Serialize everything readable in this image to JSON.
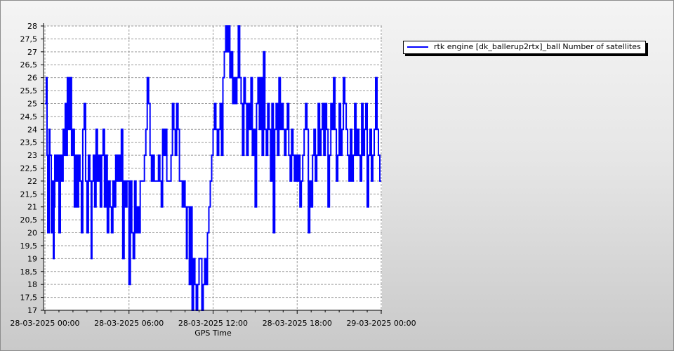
{
  "chart_data": {
    "type": "line",
    "title": "",
    "xlabel": "GPS Time",
    "ylabel": "",
    "x_ticks": [
      "28-03-2025 00:00",
      "28-03-2025 06:00",
      "28-03-2025 12:00",
      "28-03-2025 18:00",
      "29-03-2025 00:00"
    ],
    "y_ticks": [
      "17",
      "17,5",
      "18",
      "18,5",
      "19",
      "19,5",
      "20",
      "20,5",
      "21",
      "21,5",
      "22",
      "22,5",
      "23",
      "23,5",
      "24",
      "24,5",
      "25",
      "25,5",
      "26",
      "26,5",
      "27",
      "27,5",
      "28"
    ],
    "xlim": [
      -0.1,
      24.05
    ],
    "ylim": [
      17,
      28
    ],
    "grid": true,
    "legend_position": "top-right outside plot",
    "series": [
      {
        "name": "rtk engine [dk_ballerup2rtx]_ball Number of satellites",
        "color": "#0000ff",
        "x_unit": "hours since 28-03-2025 00:00",
        "points": [
          [
            0.0,
            25
          ],
          [
            0.1,
            26
          ],
          [
            0.15,
            23
          ],
          [
            0.2,
            20
          ],
          [
            0.3,
            24
          ],
          [
            0.35,
            23
          ],
          [
            0.45,
            20
          ],
          [
            0.5,
            22
          ],
          [
            0.6,
            19
          ],
          [
            0.65,
            21
          ],
          [
            0.7,
            23
          ],
          [
            0.8,
            22
          ],
          [
            0.9,
            23
          ],
          [
            1.0,
            20
          ],
          [
            1.1,
            23
          ],
          [
            1.2,
            22
          ],
          [
            1.3,
            24
          ],
          [
            1.35,
            23
          ],
          [
            1.45,
            25
          ],
          [
            1.5,
            23
          ],
          [
            1.6,
            26
          ],
          [
            1.7,
            24
          ],
          [
            1.8,
            26
          ],
          [
            1.9,
            23
          ],
          [
            2.0,
            24
          ],
          [
            2.1,
            21
          ],
          [
            2.2,
            23
          ],
          [
            2.3,
            21
          ],
          [
            2.4,
            23
          ],
          [
            2.5,
            22
          ],
          [
            2.6,
            20
          ],
          [
            2.7,
            24
          ],
          [
            2.8,
            25
          ],
          [
            2.9,
            22
          ],
          [
            3.0,
            20
          ],
          [
            3.1,
            23
          ],
          [
            3.2,
            22
          ],
          [
            3.3,
            19
          ],
          [
            3.35,
            22
          ],
          [
            3.45,
            23
          ],
          [
            3.55,
            21
          ],
          [
            3.65,
            24
          ],
          [
            3.75,
            22
          ],
          [
            3.85,
            23
          ],
          [
            3.95,
            21
          ],
          [
            4.05,
            23
          ],
          [
            4.15,
            24
          ],
          [
            4.25,
            21
          ],
          [
            4.35,
            23
          ],
          [
            4.45,
            20
          ],
          [
            4.55,
            22
          ],
          [
            4.65,
            21
          ],
          [
            4.75,
            20
          ],
          [
            4.85,
            22
          ],
          [
            4.95,
            21
          ],
          [
            5.05,
            23
          ],
          [
            5.15,
            22
          ],
          [
            5.25,
            23
          ],
          [
            5.35,
            22
          ],
          [
            5.45,
            24
          ],
          [
            5.55,
            19
          ],
          [
            5.65,
            22
          ],
          [
            5.75,
            21
          ],
          [
            5.85,
            22
          ],
          [
            6.0,
            18
          ],
          [
            6.1,
            22
          ],
          [
            6.2,
            20
          ],
          [
            6.3,
            19
          ],
          [
            6.4,
            22
          ],
          [
            6.5,
            20
          ],
          [
            6.6,
            21
          ],
          [
            6.7,
            20
          ],
          [
            6.8,
            22
          ],
          [
            7.0,
            22
          ],
          [
            7.1,
            23
          ],
          [
            7.2,
            24
          ],
          [
            7.3,
            26
          ],
          [
            7.4,
            25
          ],
          [
            7.5,
            23
          ],
          [
            7.6,
            22
          ],
          [
            7.7,
            23
          ],
          [
            7.8,
            22
          ],
          [
            8.0,
            22
          ],
          [
            8.1,
            23
          ],
          [
            8.2,
            22
          ],
          [
            8.3,
            21
          ],
          [
            8.4,
            24
          ],
          [
            8.5,
            23
          ],
          [
            8.6,
            24
          ],
          [
            8.7,
            22
          ],
          [
            8.8,
            22
          ],
          [
            9.0,
            23
          ],
          [
            9.1,
            25
          ],
          [
            9.2,
            24
          ],
          [
            9.3,
            23
          ],
          [
            9.4,
            25
          ],
          [
            9.5,
            24
          ],
          [
            9.6,
            22
          ],
          [
            9.75,
            22
          ],
          [
            9.8,
            21
          ],
          [
            9.9,
            22
          ],
          [
            10.0,
            21
          ],
          [
            10.1,
            19
          ],
          [
            10.15,
            21
          ],
          [
            10.3,
            18
          ],
          [
            10.4,
            21
          ],
          [
            10.5,
            17
          ],
          [
            10.6,
            19
          ],
          [
            10.7,
            18
          ],
          [
            10.8,
            17
          ],
          [
            10.9,
            18
          ],
          [
            11.0,
            19
          ],
          [
            11.2,
            17
          ],
          [
            11.3,
            18
          ],
          [
            11.4,
            19
          ],
          [
            11.5,
            18
          ],
          [
            11.6,
            20
          ],
          [
            11.7,
            21
          ],
          [
            11.8,
            22
          ],
          [
            11.9,
            23
          ],
          [
            12.0,
            24
          ],
          [
            12.1,
            25
          ],
          [
            12.2,
            24
          ],
          [
            12.3,
            23
          ],
          [
            12.4,
            24
          ],
          [
            12.5,
            25
          ],
          [
            12.6,
            23
          ],
          [
            12.7,
            26
          ],
          [
            12.8,
            27
          ],
          [
            12.9,
            28
          ],
          [
            13.0,
            27
          ],
          [
            13.1,
            28
          ],
          [
            13.2,
            26
          ],
          [
            13.3,
            27
          ],
          [
            13.4,
            25
          ],
          [
            13.5,
            26
          ],
          [
            13.6,
            25
          ],
          [
            13.7,
            26
          ],
          [
            13.8,
            28
          ],
          [
            13.9,
            26
          ],
          [
            14.0,
            25
          ],
          [
            14.1,
            23
          ],
          [
            14.2,
            26
          ],
          [
            14.3,
            25
          ],
          [
            14.4,
            23
          ],
          [
            14.5,
            25
          ],
          [
            14.6,
            24
          ],
          [
            14.7,
            26
          ],
          [
            14.8,
            23
          ],
          [
            14.9,
            24
          ],
          [
            15.0,
            21
          ],
          [
            15.1,
            25
          ],
          [
            15.2,
            26
          ],
          [
            15.3,
            24
          ],
          [
            15.4,
            26
          ],
          [
            15.5,
            23
          ],
          [
            15.6,
            27
          ],
          [
            15.7,
            24
          ],
          [
            15.8,
            23
          ],
          [
            15.9,
            25
          ],
          [
            16.0,
            24
          ],
          [
            16.1,
            22
          ],
          [
            16.2,
            25
          ],
          [
            16.3,
            20
          ],
          [
            16.4,
            24
          ],
          [
            16.5,
            25
          ],
          [
            16.6,
            23
          ],
          [
            16.7,
            26
          ],
          [
            16.8,
            24
          ],
          [
            16.9,
            25
          ],
          [
            17.0,
            24
          ],
          [
            17.1,
            23
          ],
          [
            17.2,
            24
          ],
          [
            17.3,
            25
          ],
          [
            17.4,
            23
          ],
          [
            17.5,
            22
          ],
          [
            17.6,
            24
          ],
          [
            17.7,
            23
          ],
          [
            17.8,
            22
          ],
          [
            17.9,
            23
          ],
          [
            18.0,
            22
          ],
          [
            18.1,
            23
          ],
          [
            18.2,
            21
          ],
          [
            18.3,
            22
          ],
          [
            18.4,
            23
          ],
          [
            18.5,
            24
          ],
          [
            18.6,
            25
          ],
          [
            18.7,
            24
          ],
          [
            18.8,
            20
          ],
          [
            18.9,
            22
          ],
          [
            19.0,
            21
          ],
          [
            19.1,
            23
          ],
          [
            19.2,
            24
          ],
          [
            19.3,
            22
          ],
          [
            19.4,
            23
          ],
          [
            19.5,
            25
          ],
          [
            19.6,
            23
          ],
          [
            19.7,
            24
          ],
          [
            19.8,
            25
          ],
          [
            19.9,
            23
          ],
          [
            20.0,
            25
          ],
          [
            20.1,
            24
          ],
          [
            20.2,
            21
          ],
          [
            20.3,
            23
          ],
          [
            20.4,
            25
          ],
          [
            20.5,
            24
          ],
          [
            20.6,
            26
          ],
          [
            20.7,
            24
          ],
          [
            20.8,
            22
          ],
          [
            20.9,
            23
          ],
          [
            21.0,
            25
          ],
          [
            21.1,
            23
          ],
          [
            21.2,
            24
          ],
          [
            21.3,
            26
          ],
          [
            21.4,
            25
          ],
          [
            21.5,
            24
          ],
          [
            21.6,
            23
          ],
          [
            21.7,
            22
          ],
          [
            21.8,
            24
          ],
          [
            21.9,
            22
          ],
          [
            22.0,
            23
          ],
          [
            22.1,
            25
          ],
          [
            22.2,
            23
          ],
          [
            22.3,
            24
          ],
          [
            22.4,
            23
          ],
          [
            22.5,
            22
          ],
          [
            22.6,
            25
          ],
          [
            22.7,
            23
          ],
          [
            22.8,
            24
          ],
          [
            22.9,
            25
          ],
          [
            23.0,
            21
          ],
          [
            23.1,
            23
          ],
          [
            23.2,
            24
          ],
          [
            23.3,
            22
          ],
          [
            23.4,
            23
          ],
          [
            23.5,
            24
          ],
          [
            23.6,
            26
          ],
          [
            23.7,
            24
          ],
          [
            23.8,
            23
          ],
          [
            23.9,
            22
          ],
          [
            24.0,
            22
          ]
        ]
      }
    ]
  }
}
